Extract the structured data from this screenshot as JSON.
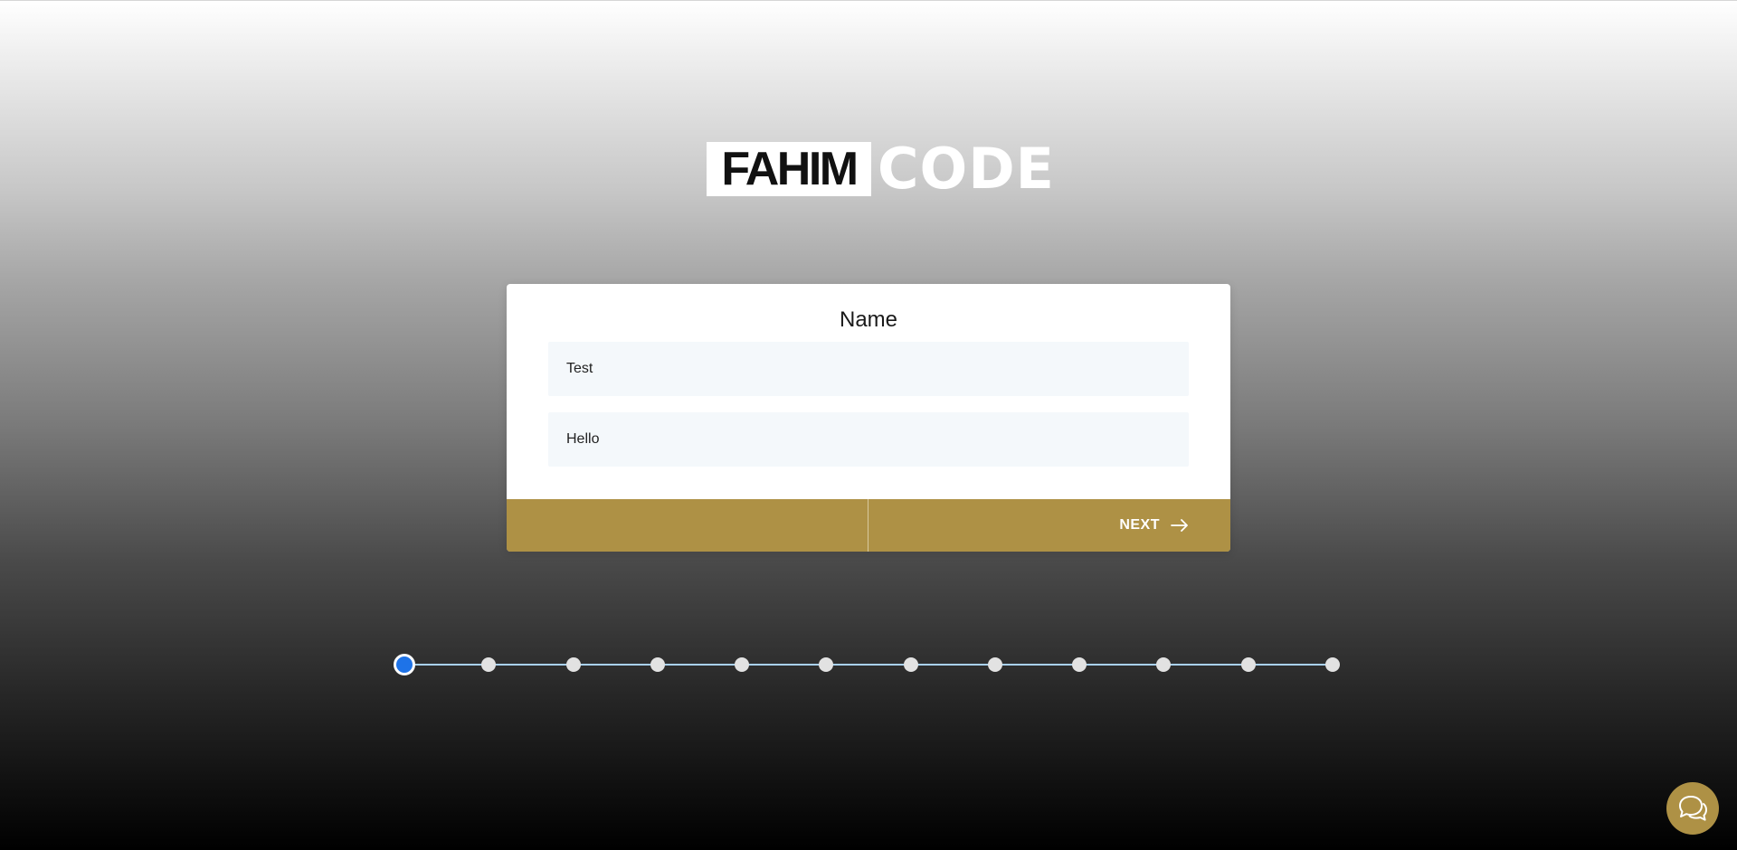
{
  "logo": {
    "box_text": "FAHIM",
    "code_text": "CODE"
  },
  "form": {
    "title": "Name",
    "fields": [
      {
        "value": "Test"
      },
      {
        "value": "Hello"
      }
    ],
    "next_label": "NEXT"
  },
  "stepper": {
    "total_steps": 12,
    "current_step": 1
  },
  "colors": {
    "accent": "#ae9145",
    "active_step": "#1e73e8",
    "step_line": "#a9d1f3",
    "field_bg": "#f4f8fb"
  },
  "icons": {
    "next": "arrow-right-icon",
    "chat": "chat-bubbles-icon"
  }
}
